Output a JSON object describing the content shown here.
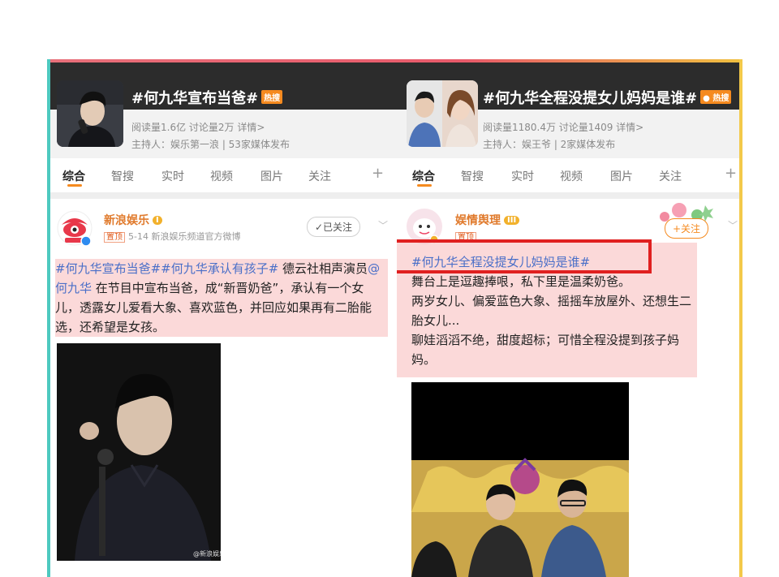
{
  "left": {
    "title": "#何九华宣布当爸#",
    "badge": "热搜",
    "stats": "阅读量1.6亿  讨论量2万  详情>",
    "host": "主持人：娱乐第一浪 | 53家媒体发布",
    "tabs": [
      "综合",
      "智搜",
      "实时",
      "视频",
      "图片",
      "关注"
    ],
    "plus": "+",
    "post": {
      "username": "新浪娱乐",
      "level": "I",
      "pin": "置顶",
      "meta": "5-14  新浪娱乐频道官方微博",
      "follow_label": "✓已关注",
      "hashtags": "#何九华宣布当爸##何九华承认有孩子#",
      "text_a": " 德云社相声演员",
      "mention": "@何九华",
      "text_b": " 在节目中宣布当爸，成“新晋奶爸”，承认有一个女儿，透露女儿爱看大象、喜欢蓝色，并回应如果再有二胎能选，还希望是女孩。",
      "watermark": "@新浪娱乐"
    }
  },
  "right": {
    "title": "#何九华全程没提女儿妈妈是谁#",
    "badge": "热搜",
    "stats": "阅读量1180.4万  讨论量1409  详情>",
    "host": "主持人：娱王爷 | 2家媒体发布",
    "tabs": [
      "综合",
      "智搜",
      "实时",
      "视频",
      "图片",
      "关注"
    ],
    "plus": "+",
    "post": {
      "username": "娱情舆理",
      "level": "III",
      "pin": "置顶",
      "follow_label": "+关注",
      "hashtag": "#何九华全程没提女儿妈妈是谁#",
      "line1": "舞台上是逗趣捧哏，私下里是温柔奶爸。",
      "line2": "两岁女儿、偏爱蓝色大象、摇摇车放屋外、还想生二胎女儿...",
      "line3": "聊娃滔滔不绝，甜度超标；可惜全程没提到孩子妈妈。"
    }
  },
  "colors": {
    "accent_orange": "#f58a1f",
    "highlight_red": "#e02020",
    "hashtag_blue": "#4a6fc8",
    "username_orange": "#e07a2c"
  }
}
